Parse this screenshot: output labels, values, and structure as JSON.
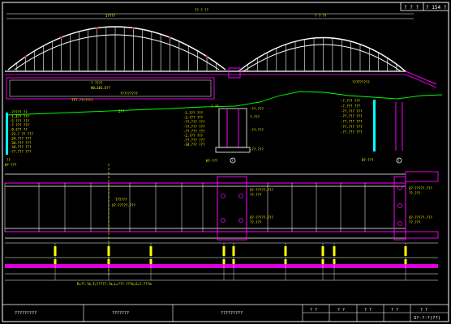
{
  "header": {
    "cells": [
      "? ? ?",
      "? 154 ?"
    ]
  },
  "top_dimension": {
    "main": "?? ? ??",
    "left_span": "1????",
    "right_span": "? ? ??"
  },
  "arch_labels": {
    "left_box_title": "? ????",
    "left_box_value": "H0=103.6??",
    "left_box_note": "?????????",
    "left_ground": "TTT.??(???)",
    "left_ground_dim": "2??",
    "right_box_title": "???T?????"
  },
  "piers": {
    "left_values": [
      "-????? ??",
      "-1.4?? ???",
      "-5.??? ???",
      "-? ??? ???",
      "-9.2?? ??",
      "-21.? ?? ???",
      "-24.??? ???",
      "-34.??? ???",
      "-34.??? ???",
      "-??.??? ???"
    ],
    "left_id": "??",
    "left_sub": "H?-???",
    "mid_values": [
      "-1.??? ???",
      "-3.??? ???",
      "-??.??? ???",
      "-??.??? ???",
      "-??.??? ???",
      "-2.??? ???",
      "-??.??? ???",
      "-34.??? ???"
    ],
    "mid_top": "? ??",
    "mid_id": "?",
    "mid_sub": "H?-???",
    "mid_right_1": "-??.???",
    "mid_right_2": "?.???",
    "mid_right_3": "-??.???",
    "mid_right_4": "-??.???",
    "right_values": [
      "-?.??? ???",
      "-?.??? ???",
      "-??.??? ???",
      "-??.??? ???",
      "-??.??? ???",
      "-??.??? ???",
      "-??.??? ???"
    ],
    "right_id": "?",
    "right_sub": "H?-???"
  },
  "plan": {
    "label_1": "T?T???",
    "label_2": "X?-?????.???",
    "pier_note_1": "X?-?????.???",
    "pier_note_2": "??.???",
    "pier_note_3": "X?-?????.???",
    "pier_note_4": "??.???",
    "right_note_1": "X?-?????.???",
    "right_note_2": "??.???",
    "right_note_3": "X?-?????.???",
    "right_note_4": "??.???"
  },
  "profile": {
    "formula": "R=??.?m,T=?????.?m,L=???.???m,E=?.???m"
  },
  "footer": {
    "cells": [
      "?????????",
      "???????",
      "?????????",
      "? ?",
      "? ?",
      "? ?",
      "? ?",
      "? ?"
    ],
    "sheet": "S?-?-?(??)"
  },
  "colors": {
    "background": "#000000",
    "line": "#ffffff",
    "text": "#ffff00",
    "accent": "#ff00ff",
    "ground": "#00ff00",
    "water": "#00ffff",
    "marker": "#ff3030"
  }
}
